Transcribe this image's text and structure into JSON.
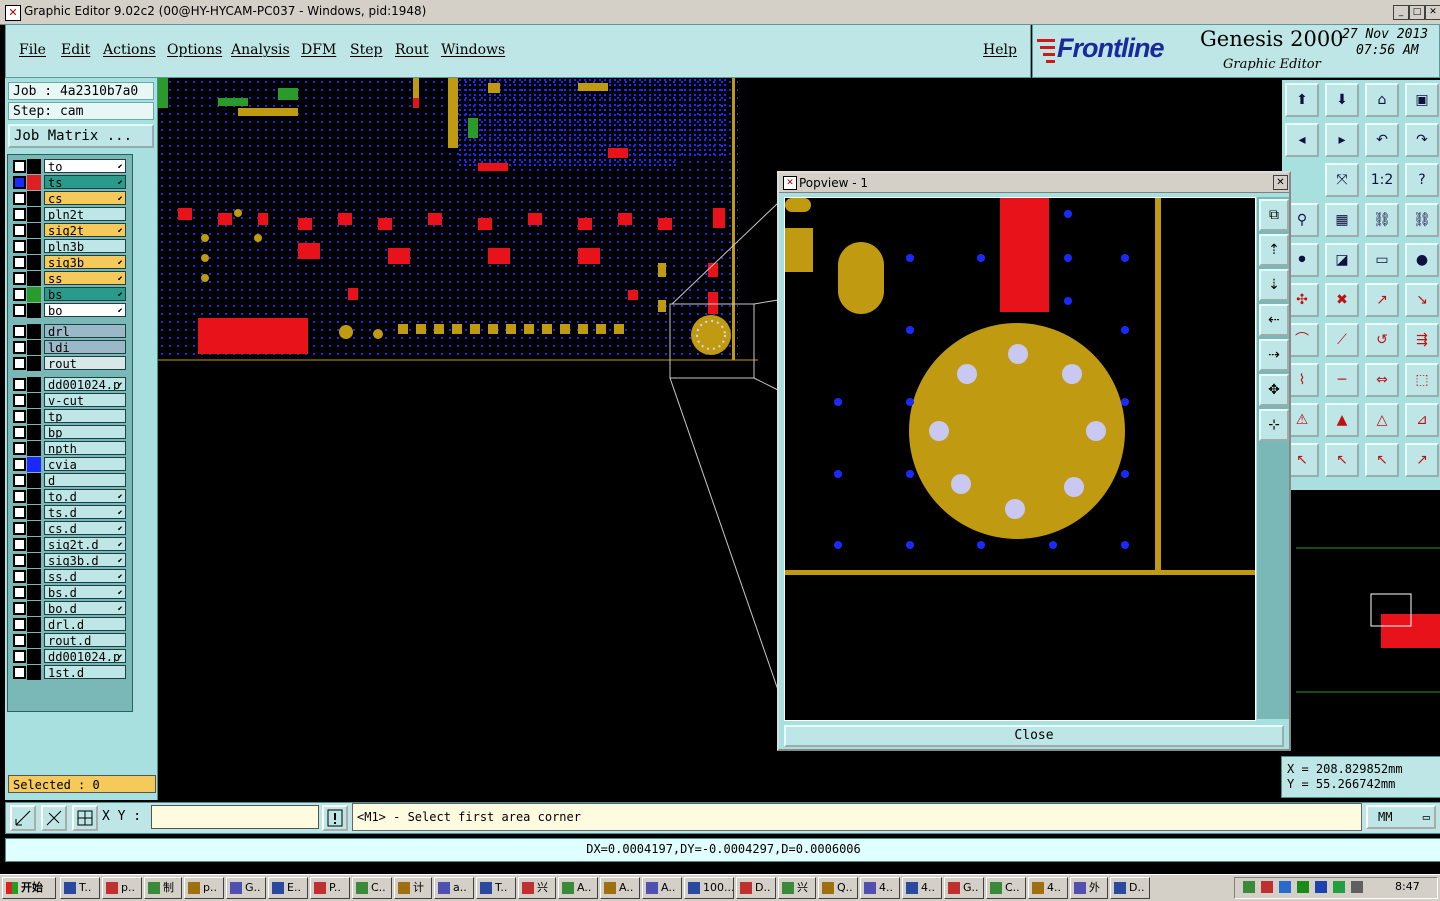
{
  "window": {
    "title": "Graphic Editor 9.02c2 (00@HY-HYCAM-PC037 - Windows, pid:1948)"
  },
  "menu": {
    "items": [
      "File",
      "Edit",
      "Actions",
      "Options",
      "Analysis",
      "DFM",
      "Step",
      "Rout",
      "Windows"
    ],
    "help": "Help"
  },
  "brand": {
    "logo": "Frontline",
    "product": "Genesis 2000",
    "subtitle": "Graphic Editor",
    "date": "27 Nov 2013",
    "time": "07:56 AM"
  },
  "job": {
    "job_label": "Job : 4a2310b7a0",
    "step_label": "Step: cam",
    "matrix_button": "Job Matrix ..."
  },
  "layers": [
    {
      "name": "to",
      "color": "#ffffff",
      "swatch": "#000000",
      "arrow": true
    },
    {
      "name": "ts",
      "color": "#2a9a8a",
      "swatch": "#e02020",
      "arrow": true,
      "checked": true
    },
    {
      "name": "cs",
      "color": "#f5c95a",
      "swatch": "#000000",
      "arrow": true
    },
    {
      "name": "pln2t",
      "color": "#bfe6e6",
      "swatch": "#000000",
      "arrow": false
    },
    {
      "name": "sig2t",
      "color": "#f5c95a",
      "swatch": "#000000",
      "arrow": true
    },
    {
      "name": "pln3b",
      "color": "#bfe6e6",
      "swatch": "#000000",
      "arrow": false
    },
    {
      "name": "sig3b",
      "color": "#f5c95a",
      "swatch": "#000000",
      "arrow": true
    },
    {
      "name": "ss",
      "color": "#f5c95a",
      "swatch": "#000000",
      "arrow": true
    },
    {
      "name": "bs",
      "color": "#2a9a8a",
      "swatch": "#2a9a2a",
      "arrow": true
    },
    {
      "name": "bo",
      "color": "#ffffff",
      "swatch": "#000000",
      "arrow": true
    },
    {
      "name": "drl",
      "color": "#9ab8c8",
      "swatch": "#000000",
      "arrow": false
    },
    {
      "name": "ldi",
      "color": "#9ab8c8",
      "swatch": "#000000",
      "arrow": false
    },
    {
      "name": "rout",
      "color": "#d8e8e8",
      "swatch": "#000000",
      "arrow": false
    },
    {
      "name": "dd001024.p",
      "color": "#bfe6e6",
      "swatch": "#000000",
      "arrow": true
    },
    {
      "name": "v-cut",
      "color": "#bfe6e6",
      "swatch": "#000000",
      "arrow": false
    },
    {
      "name": "tp",
      "color": "#bfe6e6",
      "swatch": "#000000",
      "arrow": false
    },
    {
      "name": "bp",
      "color": "#bfe6e6",
      "swatch": "#000000",
      "arrow": false
    },
    {
      "name": "npth",
      "color": "#bfe6e6",
      "swatch": "#000000",
      "arrow": false
    },
    {
      "name": "cvia",
      "color": "#bfe6e6",
      "swatch": "#1a2aff",
      "arrow": false
    },
    {
      "name": "d",
      "color": "#bfe6e6",
      "swatch": "#000000",
      "arrow": false
    },
    {
      "name": "to.d",
      "color": "#bfe6e6",
      "swatch": "#000000",
      "arrow": true
    },
    {
      "name": "ts.d",
      "color": "#bfe6e6",
      "swatch": "#000000",
      "arrow": true
    },
    {
      "name": "cs.d",
      "color": "#bfe6e6",
      "swatch": "#000000",
      "arrow": true
    },
    {
      "name": "sig2t.d",
      "color": "#bfe6e6",
      "swatch": "#000000",
      "arrow": true
    },
    {
      "name": "sig3b.d",
      "color": "#bfe6e6",
      "swatch": "#000000",
      "arrow": true
    },
    {
      "name": "ss.d",
      "color": "#bfe6e6",
      "swatch": "#000000",
      "arrow": true
    },
    {
      "name": "bs.d",
      "color": "#bfe6e6",
      "swatch": "#000000",
      "arrow": true
    },
    {
      "name": "bo.d",
      "color": "#bfe6e6",
      "swatch": "#000000",
      "arrow": true
    },
    {
      "name": "drl.d",
      "color": "#bfe6e6",
      "swatch": "#000000",
      "arrow": false
    },
    {
      "name": "rout.d",
      "color": "#bfe6e6",
      "swatch": "#000000",
      "arrow": false
    },
    {
      "name": "dd001024.p",
      "color": "#bfe6e6",
      "swatch": "#000000",
      "arrow": true
    },
    {
      "name": "1st.d",
      "color": "#bfe6e6",
      "swatch": "#000000",
      "arrow": false
    }
  ],
  "selected": "Selected : 0",
  "popview": {
    "title": "Popview - 1",
    "close_label": "Close"
  },
  "coords": {
    "x": "X = 208.829852mm",
    "y": "Y =  55.266742mm"
  },
  "command": {
    "xy_label": "X Y :",
    "xy_value": "",
    "prompt": "<M1> - Select first area corner",
    "units": "MM"
  },
  "status": "DX=0.0004197,DY=-0.0004297,D=0.0006006",
  "taskbar": {
    "start": "开始",
    "tasks": [
      "T..",
      "p..",
      "制",
      "p..",
      "G..",
      "E..",
      "P..",
      "C..",
      "计",
      "a..",
      "T..",
      "兴",
      "A..",
      "A..",
      "A..",
      "100...",
      "D..",
      "兴",
      "Q..",
      "4..",
      "4..",
      "G..",
      "C..",
      "4..",
      "外",
      "D.."
    ],
    "clock": "8:47"
  }
}
